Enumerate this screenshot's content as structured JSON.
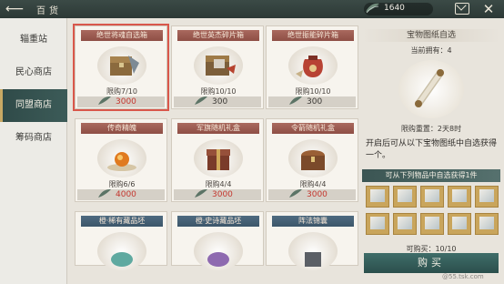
{
  "topbar": {
    "title": "百货",
    "currency_value": "1640",
    "currency_icon": "jade-leaf-icon"
  },
  "sidebar": {
    "items": [
      {
        "label": "辎重站",
        "active": false
      },
      {
        "label": "民心商店",
        "active": false
      },
      {
        "label": "同盟商店",
        "active": true
      },
      {
        "label": "筹码商店",
        "active": false
      }
    ]
  },
  "cards": [
    {
      "title": "绝世将魂自选箱",
      "limit": "限购7/10",
      "price": "3000",
      "price_red": true,
      "selected": true
    },
    {
      "title": "绝世英杰碎片箱",
      "limit": "限购10/10",
      "price": "300",
      "price_red": false,
      "selected": false
    },
    {
      "title": "绝世振能碎片箱",
      "limit": "限购10/10",
      "price": "300",
      "price_red": false,
      "selected": false
    },
    {
      "title": "传奇精魄",
      "limit": "限购6/6",
      "price": "4000",
      "price_red": true,
      "selected": false
    },
    {
      "title": "军旗随机礼盒",
      "limit": "限购4/4",
      "price": "3000",
      "price_red": true,
      "selected": false
    },
    {
      "title": "令箭随机礼盒",
      "limit": "限购4/4",
      "price": "3000",
      "price_red": true,
      "selected": false
    },
    {
      "title": "橙·稀有藏品坯",
      "limit": "",
      "price": "",
      "price_red": false,
      "selected": false
    },
    {
      "title": "橙·史诗藏品坯",
      "limit": "",
      "price": "",
      "price_red": false,
      "selected": false
    },
    {
      "title": "阵法锦囊",
      "limit": "",
      "price": "",
      "price_red": false,
      "selected": false
    }
  ],
  "panel": {
    "title": "宝物图纸自选",
    "owned": "当前拥有：4",
    "reset": "限购重置：2天8时",
    "description": "开启后可从以下宝物图纸中自选获得一个。",
    "subhead": "可从下列物品中自选获得1件",
    "can_buy": "可购买：10/10",
    "buy_label": "购买"
  },
  "watermark": "@55.tsk.com",
  "colors": {
    "accent_teal": "#2f4a48",
    "banner_red": "#8e4e45",
    "price_red": "#c4362e",
    "selection_red": "#d9574b"
  }
}
